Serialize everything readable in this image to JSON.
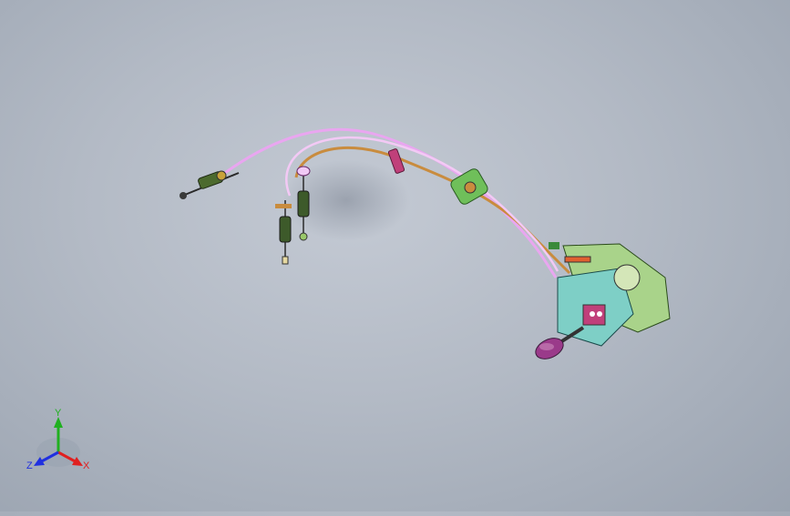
{
  "viewport": {
    "background_top": "#c4cad4",
    "background_bottom": "#9aa3b0"
  },
  "model": {
    "cable_colors": [
      "#e9a6f0",
      "#c98c3e",
      "#f0c4f4"
    ],
    "housing_color": "#7ecfc6",
    "bracket_color": "#a9d38a",
    "knob_color": "#9a3a8a"
  },
  "triad": {
    "x_label": "X",
    "y_label": "Y",
    "z_label": "Z",
    "x_color": "#e02020",
    "y_color": "#20b020",
    "z_color": "#2030e0"
  }
}
